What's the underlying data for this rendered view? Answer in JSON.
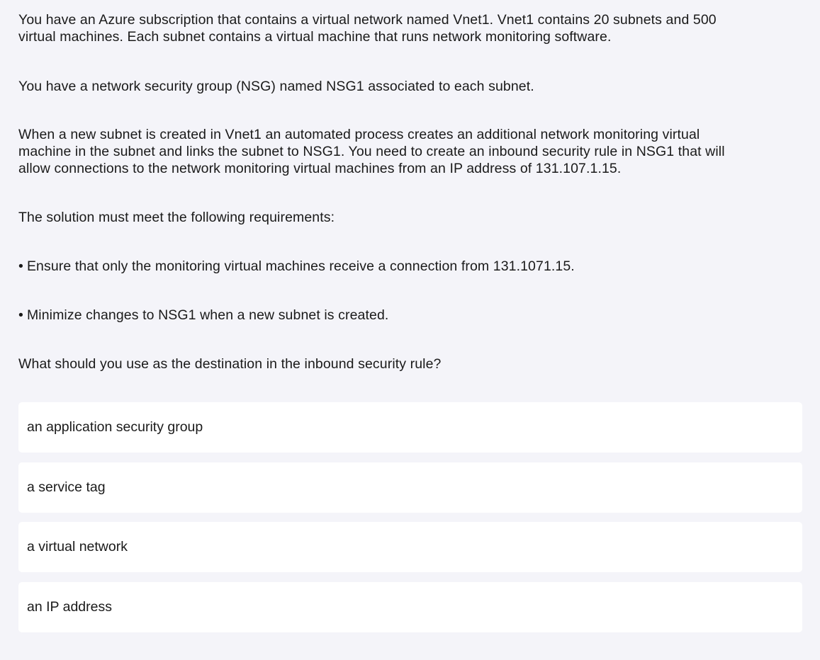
{
  "question": {
    "paragraphs": [
      "You have an Azure subscription that contains a virtual network named Vnet1. Vnet1 contains 20 subnets and 500 virtual machines. Each subnet contains a virtual machine that runs network monitoring software.",
      "You have a network security group (NSG) named NSG1 associated to each subnet.",
      "When a new subnet is created in Vnet1 an automated process creates an additional network monitoring virtual machine in the subnet and links the subnet to NSG1. You need to create an inbound security rule in NSG1 that will allow connections to the network monitoring virtual machines from an IP address of 131.107.1.15.",
      "The solution must meet the following requirements:"
    ],
    "bullet_symbol": "•",
    "requirements": [
      "Ensure that only the monitoring virtual machines receive a connection from 131.1071.15.",
      "Minimize changes to NSG1 when a new subnet is created."
    ],
    "prompt": "What should you use as the destination in the inbound security rule?"
  },
  "options": [
    {
      "label": "an application security group"
    },
    {
      "label": "a service tag"
    },
    {
      "label": "a virtual network"
    },
    {
      "label": "an IP address"
    }
  ]
}
